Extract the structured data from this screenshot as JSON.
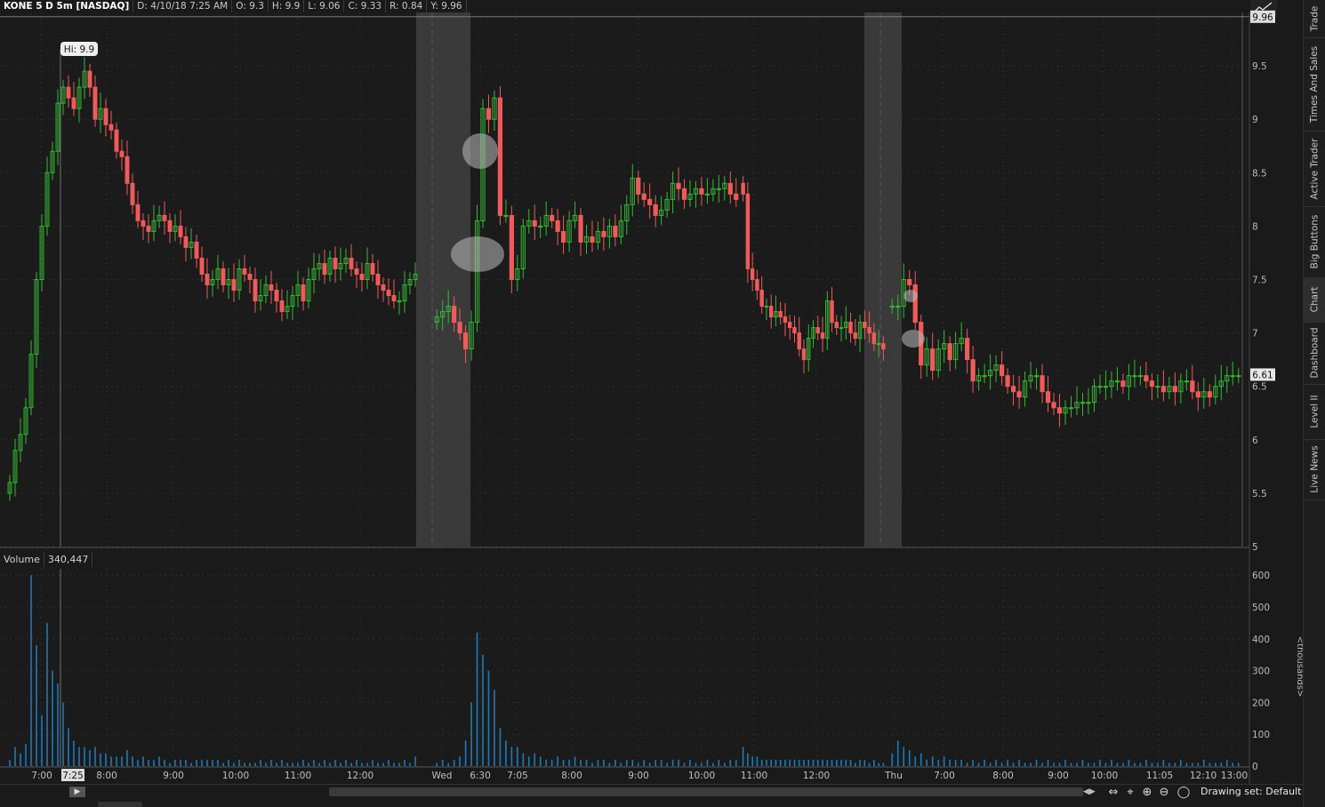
{
  "header": {
    "symbol": "KONE 5 D 5m [NASDAQ]",
    "date": "D: 4/10/18 7:25 AM",
    "open": "O: 9.3",
    "high": "H: 9.9",
    "low": "L: 9.06",
    "close": "C: 9.33",
    "range": "R: 0.84",
    "y": "Y: 9.96"
  },
  "price_axis": {
    "ticks": [
      "9.5",
      "9",
      "8.5",
      "8",
      "7.5",
      "7",
      "6.5",
      "6",
      "5.5",
      "5"
    ],
    "crosshair_label": "9.96",
    "last_label": "6.61",
    "hi_label": "Hi: 9.9"
  },
  "volume_panel": {
    "label": "Volume",
    "value": "340,447",
    "ticks": [
      "600",
      "500",
      "400",
      "300",
      "200",
      "100",
      "0"
    ],
    "unit_label": "<thousands>"
  },
  "time_axis": {
    "labels": [
      "7:00",
      "7:25",
      "8:00",
      "9:00",
      "10:00",
      "11:00",
      "12:00",
      "Wed",
      "6:30",
      "7:05",
      "8:00",
      "9:00",
      "10:00",
      "11:00",
      "12:00",
      "Thu",
      "7:00",
      "8:00",
      "9:00",
      "10:00",
      "11:05",
      "12:10",
      "13:00"
    ]
  },
  "right_tabs": [
    "Trade",
    "Times And Sales",
    "Active Trader",
    "Big Buttons",
    "Chart",
    "Dashboard",
    "Level II",
    "Live News"
  ],
  "active_tab": "Chart",
  "toolbar": {
    "drawing_set": "Drawing set: Default"
  },
  "colors": {
    "up": "#35b935",
    "down": "#f05a5a",
    "volume": "#1f7ab8",
    "background": "#1b1b1b",
    "session_shade": "#3a3a3a"
  },
  "chart_data": {
    "type": "candlestick",
    "interval": "5m",
    "ylim": [
      5,
      10
    ],
    "volume_ylim": [
      0,
      620
    ],
    "day1": {
      "x_range": [
        "6:45",
        "13:15"
      ],
      "close": [
        5.6,
        5.9,
        6.05,
        6.3,
        6.8,
        7.5,
        8.0,
        8.5,
        8.7,
        9.15,
        9.3,
        9.2,
        9.1,
        9.3,
        9.45,
        9.3,
        9.0,
        9.1,
        8.95,
        8.9,
        8.7,
        8.65,
        8.4,
        8.2,
        8.05,
        8.0,
        7.95,
        8.05,
        8.1,
        8.05,
        7.95,
        8.0,
        7.9,
        7.8,
        7.85,
        7.7,
        7.55,
        7.45,
        7.5,
        7.6,
        7.45,
        7.5,
        7.4,
        7.6,
        7.55,
        7.5,
        7.3,
        7.35,
        7.45,
        7.4,
        7.3,
        7.2,
        7.25,
        7.35,
        7.45,
        7.3,
        7.5,
        7.6,
        7.65,
        7.55,
        7.7,
        7.6,
        7.65,
        7.7,
        7.6,
        7.55,
        7.5,
        7.65,
        7.55,
        7.45,
        7.4,
        7.35,
        7.3,
        7.3,
        7.45,
        7.5,
        7.55
      ],
      "volume_k": [
        20,
        60,
        40,
        70,
        600,
        380,
        160,
        450,
        300,
        260,
        200,
        120,
        80,
        60,
        60,
        50,
        60,
        40,
        40,
        30,
        30,
        30,
        50,
        30,
        20,
        30,
        20,
        20,
        30,
        20,
        10,
        20,
        20,
        20,
        10,
        20,
        20,
        20,
        20,
        20,
        10,
        20,
        10,
        20,
        10,
        10,
        10,
        20,
        10,
        20,
        10,
        20,
        10,
        10,
        10,
        20,
        10,
        20,
        10,
        20,
        10,
        20,
        10,
        20,
        10,
        20,
        10,
        10,
        20,
        10,
        10,
        20,
        10,
        10,
        20,
        10,
        30
      ]
    },
    "day2": {
      "x_range": [
        "6:15",
        "10:45"
      ],
      "close": [
        7.15,
        7.2,
        7.25,
        7.1,
        7.0,
        6.85,
        7.1,
        8.05,
        9.1,
        9.0,
        9.2,
        8.1,
        8.1,
        7.5,
        7.6,
        8.0,
        8.05,
        8.0,
        8.0,
        8.1,
        8.05,
        7.95,
        7.85,
        8.05,
        8.1,
        7.85,
        7.9,
        7.85,
        7.95,
        7.9,
        8.0,
        7.9,
        8.05,
        8.2,
        8.45,
        8.3,
        8.25,
        8.2,
        8.1,
        8.15,
        8.25,
        8.4,
        8.35,
        8.25,
        8.3,
        8.35,
        8.3,
        8.3,
        8.35,
        8.35,
        8.4,
        8.3,
        8.25
      ],
      "volume_k": [
        10,
        20,
        10,
        20,
        30,
        80,
        200,
        420,
        350,
        300,
        240,
        120,
        80,
        60,
        60,
        40,
        30,
        40,
        30,
        20,
        20,
        30,
        20,
        20,
        30,
        20,
        20,
        10,
        20,
        20,
        10,
        20,
        10,
        20,
        20,
        10,
        20,
        10,
        20,
        20,
        10,
        20,
        20,
        10,
        20,
        10,
        10,
        20,
        10,
        20,
        10,
        20,
        20
      ]
    },
    "day3": {
      "x_range": [
        "10:45",
        "15:45"
      ],
      "close": [
        8.3,
        7.6,
        7.5,
        7.4,
        7.25,
        7.25,
        7.15,
        7.2,
        7.15,
        7.1,
        7.05,
        7.0,
        6.85,
        6.75,
        6.95,
        7.05,
        7.0,
        6.95,
        7.3,
        7.1,
        7.05,
        7.05,
        7.1,
        7.0,
        6.95,
        7.1,
        7.05,
        7.0,
        6.9,
        6.9,
        6.85
      ],
      "volume_k": [
        60,
        40,
        30,
        30,
        20,
        20,
        20,
        20,
        20,
        20,
        20,
        20,
        20,
        20,
        20,
        20,
        20,
        20,
        20,
        20,
        20,
        20,
        20,
        20,
        10,
        20,
        20,
        10,
        20,
        10,
        10
      ]
    },
    "day4": {
      "x_range": [
        "6:30",
        "13:15"
      ],
      "close": [
        7.25,
        7.25,
        7.5,
        7.45,
        7.1,
        6.7,
        6.85,
        6.65,
        6.85,
        6.9,
        6.75,
        6.9,
        6.95,
        6.75,
        6.55,
        6.6,
        6.6,
        6.65,
        6.7,
        6.6,
        6.5,
        6.45,
        6.4,
        6.55,
        6.6,
        6.6,
        6.45,
        6.35,
        6.3,
        6.25,
        6.3,
        6.3,
        6.35,
        6.35,
        6.35,
        6.5,
        6.5,
        6.5,
        6.55,
        6.55,
        6.5,
        6.6,
        6.6,
        6.6,
        6.55,
        6.5,
        6.5,
        6.45,
        6.5,
        6.45,
        6.55,
        6.55,
        6.45,
        6.4,
        6.45,
        6.4,
        6.5,
        6.55,
        6.6,
        6.6,
        6.6
      ],
      "volume_k": [
        40,
        80,
        60,
        50,
        30,
        40,
        20,
        30,
        20,
        30,
        20,
        20,
        20,
        10,
        20,
        10,
        20,
        10,
        20,
        10,
        20,
        10,
        20,
        10,
        10,
        20,
        10,
        20,
        10,
        10,
        20,
        10,
        10,
        20,
        10,
        10,
        20,
        10,
        20,
        10,
        10,
        20,
        10,
        10,
        20,
        10,
        10,
        20,
        10,
        10,
        20,
        10,
        10,
        10,
        20,
        10,
        10,
        10,
        20,
        10,
        10
      ]
    },
    "hi": 9.9,
    "last": 6.61
  }
}
